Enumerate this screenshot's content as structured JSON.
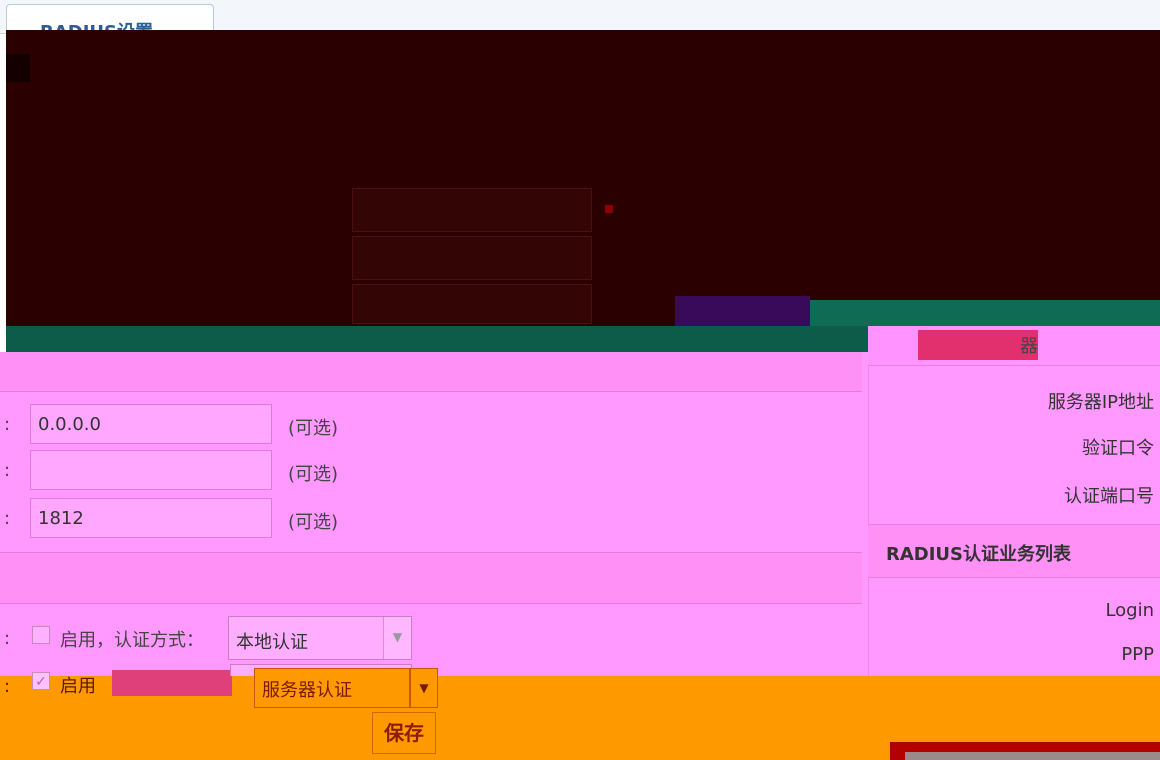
{
  "tab": {
    "label": "RADIUS设置"
  },
  "form": {
    "rows": [
      {
        "value": "0.0.0.0",
        "hint": "(可选)"
      },
      {
        "value": "",
        "hint": "(可选)"
      },
      {
        "value": "1812",
        "hint": "(可选)"
      }
    ],
    "auth_row_1": {
      "enable_label": "启用，认证方式：",
      "enabled": false,
      "method": "本地认证"
    },
    "auth_row_2": {
      "enable_label": "启用",
      "enabled": true,
      "method": "服务器认证"
    },
    "save_label": "保存"
  },
  "right_panel": {
    "head": "器",
    "fields": [
      "服务器IP地址",
      "验证口令",
      "认证端口号"
    ],
    "list_title": "RADIUS认证业务列表",
    "list_items": [
      "Login",
      "PPP"
    ]
  },
  "colors": {
    "pink": "#ff99ff",
    "orange": "#ff9900",
    "dark": "#2b0000"
  }
}
